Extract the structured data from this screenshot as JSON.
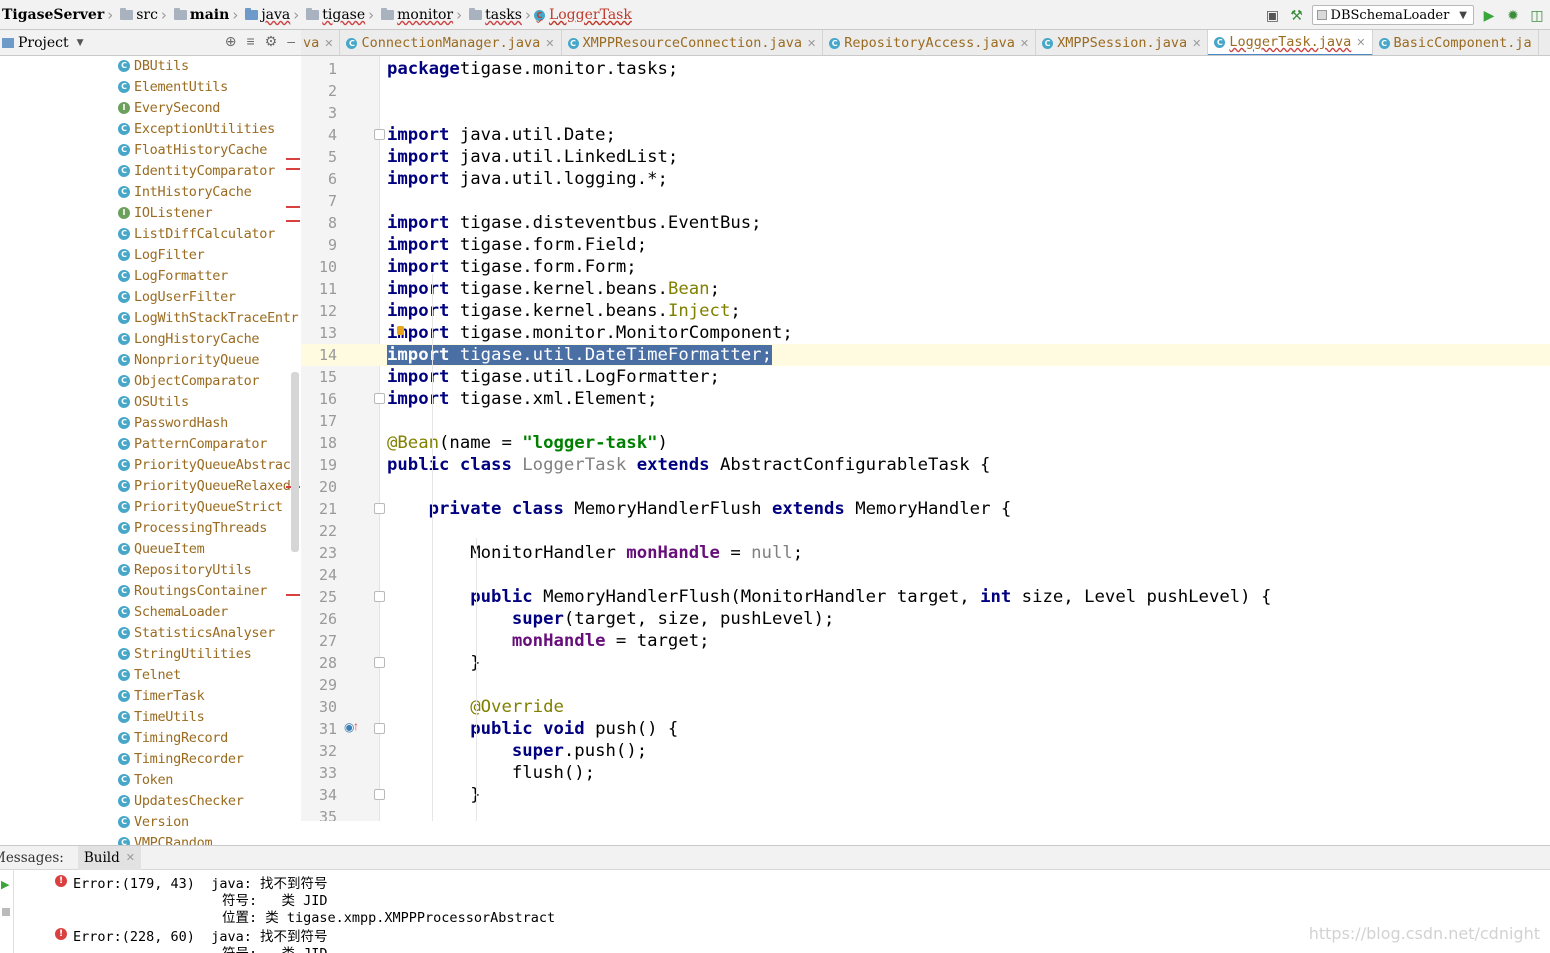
{
  "breadcrumb": {
    "items": [
      {
        "label": "TigaseServer",
        "style": "bold"
      },
      {
        "label": "src",
        "style": "folder"
      },
      {
        "label": "main",
        "style": "bold-folder"
      },
      {
        "label": "java",
        "style": "ul-folder-blue"
      },
      {
        "label": "tigase",
        "style": "ul-folder"
      },
      {
        "label": "monitor",
        "style": "ul-folder"
      },
      {
        "label": "tasks",
        "style": "ul-folder"
      },
      {
        "label": "LoggerTask",
        "style": "class-red"
      }
    ]
  },
  "toolbar": {
    "run_config": "DBSchemaLoader"
  },
  "project_panel": {
    "title": "Project"
  },
  "tree": {
    "items": [
      {
        "label": "DBUtils",
        "kind": "class"
      },
      {
        "label": "ElementUtils",
        "kind": "class"
      },
      {
        "label": "EverySecond",
        "kind": "interface"
      },
      {
        "label": "ExceptionUtilities",
        "kind": "class"
      },
      {
        "label": "FloatHistoryCache",
        "kind": "class"
      },
      {
        "label": "IdentityComparator",
        "kind": "class"
      },
      {
        "label": "IntHistoryCache",
        "kind": "class"
      },
      {
        "label": "IOListener",
        "kind": "interface"
      },
      {
        "label": "ListDiffCalculator",
        "kind": "class"
      },
      {
        "label": "LogFilter",
        "kind": "class"
      },
      {
        "label": "LogFormatter",
        "kind": "class"
      },
      {
        "label": "LogUserFilter",
        "kind": "class"
      },
      {
        "label": "LogWithStackTraceEntr",
        "kind": "class"
      },
      {
        "label": "LongHistoryCache",
        "kind": "class"
      },
      {
        "label": "NonpriorityQueue",
        "kind": "class"
      },
      {
        "label": "ObjectComparator",
        "kind": "class"
      },
      {
        "label": "OSUtils",
        "kind": "class"
      },
      {
        "label": "PasswordHash",
        "kind": "class"
      },
      {
        "label": "PatternComparator",
        "kind": "class"
      },
      {
        "label": "PriorityQueueAbstract",
        "kind": "class"
      },
      {
        "label": "PriorityQueueRelaxed",
        "kind": "class"
      },
      {
        "label": "PriorityQueueStrict",
        "kind": "class"
      },
      {
        "label": "ProcessingThreads",
        "kind": "class"
      },
      {
        "label": "QueueItem",
        "kind": "class"
      },
      {
        "label": "RepositoryUtils",
        "kind": "class"
      },
      {
        "label": "RoutingsContainer",
        "kind": "class"
      },
      {
        "label": "SchemaLoader",
        "kind": "class"
      },
      {
        "label": "StatisticsAnalyser",
        "kind": "class"
      },
      {
        "label": "StringUtilities",
        "kind": "class"
      },
      {
        "label": "Telnet",
        "kind": "class"
      },
      {
        "label": "TimerTask",
        "kind": "class"
      },
      {
        "label": "TimeUtils",
        "kind": "class"
      },
      {
        "label": "TimingRecord",
        "kind": "class"
      },
      {
        "label": "TimingRecorder",
        "kind": "class"
      },
      {
        "label": "Token",
        "kind": "class"
      },
      {
        "label": "UpdatesChecker",
        "kind": "class"
      },
      {
        "label": "Version",
        "kind": "class"
      },
      {
        "label": "VMPCRandom",
        "kind": "class"
      }
    ]
  },
  "tabs": [
    {
      "label": "va",
      "active": false
    },
    {
      "label": "ConnectionManager.java",
      "active": false
    },
    {
      "label": "XMPPResourceConnection.java",
      "active": false
    },
    {
      "label": "RepositoryAccess.java",
      "active": false
    },
    {
      "label": "XMPPSession.java",
      "active": false
    },
    {
      "label": "LoggerTask.java",
      "active": true
    },
    {
      "label": "BasicComponent.ja",
      "active": false
    }
  ],
  "editor": {
    "current_line": 14,
    "lines": [
      {
        "n": "1",
        "segs": [
          [
            "kw",
            "package"
          ],
          [
            "",
            "tigase.monitor.tasks;"
          ]
        ]
      },
      {
        "n": "2",
        "segs": []
      },
      {
        "n": "3",
        "segs": []
      },
      {
        "n": "4",
        "segs": [
          [
            "kw",
            "import"
          ],
          [
            "",
            " java.util.Date;"
          ]
        ]
      },
      {
        "n": "5",
        "segs": [
          [
            "kw",
            "import"
          ],
          [
            "",
            " java.util.LinkedList;"
          ]
        ]
      },
      {
        "n": "6",
        "segs": [
          [
            "kw",
            "import"
          ],
          [
            "",
            " java.util.logging.*;"
          ]
        ]
      },
      {
        "n": "7",
        "segs": []
      },
      {
        "n": "8",
        "segs": [
          [
            "kw",
            "import"
          ],
          [
            "",
            " tigase.disteventbus.EventBus;"
          ]
        ]
      },
      {
        "n": "9",
        "segs": [
          [
            "kw",
            "import"
          ],
          [
            "",
            " tigase.form.Field;"
          ]
        ]
      },
      {
        "n": "10",
        "segs": [
          [
            "kw",
            "import"
          ],
          [
            "",
            " tigase.form.Form;"
          ]
        ]
      },
      {
        "n": "11",
        "segs": [
          [
            "kw",
            "import"
          ],
          [
            "",
            " tigase.kernel.beans."
          ],
          [
            "ann",
            "Bean"
          ],
          [
            "",
            ";"
          ]
        ]
      },
      {
        "n": "12",
        "segs": [
          [
            "kw",
            "import"
          ],
          [
            "",
            " tigase.kernel.beans."
          ],
          [
            "ann",
            "Inject"
          ],
          [
            "",
            ";"
          ]
        ]
      },
      {
        "n": "13",
        "segs": [
          [
            "kw",
            "import"
          ],
          [
            "",
            " tigase.monitor.MonitorComponent;"
          ]
        ]
      },
      {
        "n": "14",
        "segs": [
          [
            "sel-kw",
            "import"
          ],
          [
            "sel",
            " tigase.util.DateTimeFormatter;"
          ]
        ]
      },
      {
        "n": "15",
        "segs": [
          [
            "kw",
            "import"
          ],
          [
            "",
            " tigase.util.LogFormatter;"
          ]
        ]
      },
      {
        "n": "16",
        "segs": [
          [
            "kw",
            "import"
          ],
          [
            "",
            " tigase.xml.Element;"
          ]
        ]
      },
      {
        "n": "17",
        "segs": []
      },
      {
        "n": "18",
        "segs": [
          [
            "ann",
            "@Bean"
          ],
          [
            "",
            "(name = "
          ],
          [
            "str",
            "\"logger-task\""
          ],
          [
            "",
            ")"
          ]
        ]
      },
      {
        "n": "19",
        "segs": [
          [
            "kw",
            "public class"
          ],
          [
            "grey",
            " LoggerTask"
          ],
          [
            "kw",
            " extends"
          ],
          [
            "",
            " AbstractConfigurableTask {"
          ]
        ]
      },
      {
        "n": "20",
        "segs": []
      },
      {
        "n": "21",
        "segs": [
          [
            "",
            "    "
          ],
          [
            "kw",
            "private class"
          ],
          [
            "",
            " MemoryHandlerFlush "
          ],
          [
            "kw",
            "extends"
          ],
          [
            "",
            " MemoryHandler {"
          ]
        ]
      },
      {
        "n": "22",
        "segs": []
      },
      {
        "n": "23",
        "segs": [
          [
            "",
            "        MonitorHandler "
          ],
          [
            "fld",
            "monHandle"
          ],
          [
            "",
            " = "
          ],
          [
            "grey",
            "null"
          ],
          [
            "",
            ";"
          ]
        ]
      },
      {
        "n": "24",
        "segs": []
      },
      {
        "n": "25",
        "segs": [
          [
            "",
            "        "
          ],
          [
            "kw",
            "public"
          ],
          [
            "",
            " MemoryHandlerFlush(MonitorHandler target, "
          ],
          [
            "kw",
            "int"
          ],
          [
            "",
            " size, Level pushLevel) {"
          ]
        ]
      },
      {
        "n": "26",
        "segs": [
          [
            "",
            "            "
          ],
          [
            "kw",
            "super"
          ],
          [
            "",
            "(target, size, pushLevel);"
          ]
        ]
      },
      {
        "n": "27",
        "segs": [
          [
            "",
            "            "
          ],
          [
            "fld",
            "monHandle"
          ],
          [
            "",
            " = target;"
          ]
        ]
      },
      {
        "n": "28",
        "segs": [
          [
            "",
            "        }"
          ]
        ]
      },
      {
        "n": "29",
        "segs": []
      },
      {
        "n": "30",
        "segs": [
          [
            "",
            "        "
          ],
          [
            "ann",
            "@Override"
          ]
        ]
      },
      {
        "n": "31",
        "segs": [
          [
            "",
            "        "
          ],
          [
            "kw",
            "public void"
          ],
          [
            "",
            " push() {"
          ]
        ]
      },
      {
        "n": "32",
        "segs": [
          [
            "",
            "            "
          ],
          [
            "kw",
            "super"
          ],
          [
            "",
            ".push();"
          ]
        ]
      },
      {
        "n": "33",
        "segs": [
          [
            "",
            "            flush();"
          ]
        ]
      },
      {
        "n": "34",
        "segs": [
          [
            "",
            "        }"
          ]
        ]
      },
      {
        "n": "35",
        "segs": []
      }
    ]
  },
  "messages": {
    "title": "Messages:",
    "tab_build": "Build",
    "errors": [
      {
        "location": "Error:(179, 43)",
        "text": "java: 找不到符号",
        "symbol": "符号:   类 JID",
        "position": "位置: 类 tigase.xmpp.XMPPProcessorAbstract"
      },
      {
        "location": "Error:(228, 60)",
        "text": "java: 找不到符号",
        "symbol": "符号:   类 JID",
        "position": ""
      }
    ]
  },
  "watermark": "https://blog.csdn.net/cdnight"
}
